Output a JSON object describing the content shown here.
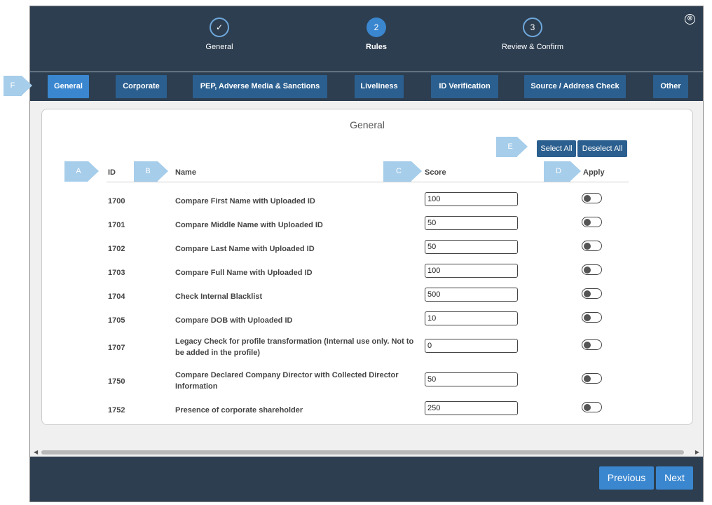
{
  "wizard": {
    "steps": [
      {
        "number": "✓",
        "label": "General"
      },
      {
        "number": "2",
        "label": "Rules"
      },
      {
        "number": "3",
        "label": "Review & Confirm"
      }
    ],
    "close_icon": "⊗"
  },
  "tabs": [
    {
      "label": "General"
    },
    {
      "label": "Corporate"
    },
    {
      "label": "PEP, Adverse Media & Sanctions"
    },
    {
      "label": "Liveliness"
    },
    {
      "label": "ID Verification"
    },
    {
      "label": "Source / Address Check"
    },
    {
      "label": "Other"
    }
  ],
  "card": {
    "title": "General",
    "select_all": "Select All",
    "deselect_all": "Deselect All"
  },
  "table": {
    "headers": {
      "id": "ID",
      "name": "Name",
      "score": "Score",
      "apply": "Apply"
    },
    "rows": [
      {
        "id": "1700",
        "name": "Compare First Name with Uploaded ID",
        "score": "100",
        "apply": false
      },
      {
        "id": "1701",
        "name": "Compare Middle Name with Uploaded ID",
        "score": "50",
        "apply": false
      },
      {
        "id": "1702",
        "name": "Compare Last Name with Uploaded ID",
        "score": "50",
        "apply": false
      },
      {
        "id": "1703",
        "name": "Compare Full Name with Uploaded ID",
        "score": "100",
        "apply": false
      },
      {
        "id": "1704",
        "name": "Check Internal Blacklist",
        "score": "500",
        "apply": false
      },
      {
        "id": "1705",
        "name": "Compare DOB with Uploaded ID",
        "score": "10",
        "apply": false
      },
      {
        "id": "1707",
        "name": "Legacy Check for profile transformation (Internal use only. Not to be added in the profile)",
        "score": "0",
        "apply": false
      },
      {
        "id": "1750",
        "name": "Compare Declared Company Director with Collected Director Information",
        "score": "50",
        "apply": false
      },
      {
        "id": "1752",
        "name": "Presence of corporate shareholder",
        "score": "250",
        "apply": false
      }
    ]
  },
  "footer": {
    "previous": "Previous",
    "next": "Next"
  },
  "markers": {
    "a": "A",
    "b": "B",
    "c": "C",
    "d": "D",
    "e": "E",
    "f": "F"
  },
  "colors": {
    "header_bg": "#2d3e50",
    "accent": "#3a87d0",
    "tab_bg": "#2b5f8f",
    "marker": "#a6cdea"
  }
}
